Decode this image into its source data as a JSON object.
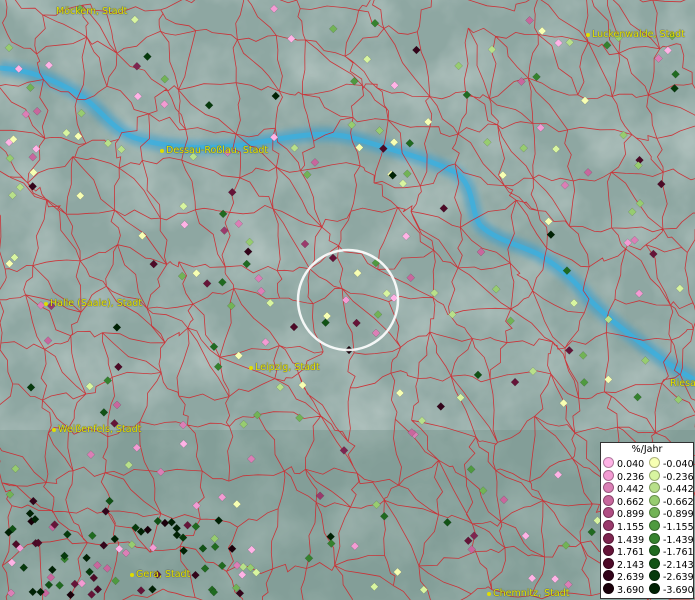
{
  "cities": [
    {
      "name": "Möckern, Stadt",
      "marker": false
    },
    {
      "name": "Luckenwalde, Stadt",
      "marker": true
    },
    {
      "name": "Dessau-Roßlau, Stadt",
      "marker": true
    },
    {
      "name": "Halle (Saale), Stadt",
      "marker": true
    },
    {
      "name": "Leipzig, Stadt",
      "marker": true
    },
    {
      "name": "Weißenfels, Stadt",
      "marker": true
    },
    {
      "name": "Gera, Stadt",
      "marker": true
    },
    {
      "name": "Chemnitz, Stadt",
      "marker": true
    },
    {
      "name": "Riesa",
      "marker": false
    }
  ],
  "legend": {
    "title": "%/Jahr",
    "positive": [
      {
        "label": "0.040",
        "color": "#ffb3e6"
      },
      {
        "label": "0.236",
        "color": "#f39bd3"
      },
      {
        "label": "0.442",
        "color": "#db7fb6"
      },
      {
        "label": "0.662",
        "color": "#c8679d"
      },
      {
        "label": "0.899",
        "color": "#b04d83"
      },
      {
        "label": "1.155",
        "color": "#9a3a6c"
      },
      {
        "label": "1.439",
        "color": "#7e2550"
      },
      {
        "label": "1.761",
        "color": "#651438"
      },
      {
        "label": "2.143",
        "color": "#4d0a27"
      },
      {
        "label": "2.639",
        "color": "#33041a"
      },
      {
        "label": "3.690",
        "color": "#1a000a"
      }
    ],
    "negative": [
      {
        "label": "-0.040",
        "color": "#f7ffb3"
      },
      {
        "label": "-0.236",
        "color": "#d8f5a0"
      },
      {
        "label": "-0.442",
        "color": "#b8e08a"
      },
      {
        "label": "-0.662",
        "color": "#97cc70"
      },
      {
        "label": "-0.899",
        "color": "#72b356"
      },
      {
        "label": "-1.155",
        "color": "#4f9a40"
      },
      {
        "label": "-1.439",
        "color": "#35822e"
      },
      {
        "label": "-1.761",
        "color": "#206a20"
      },
      {
        "label": "-2.143",
        "color": "#115215"
      },
      {
        "label": "-2.639",
        "color": "#063a0c"
      },
      {
        "label": "-3.690",
        "color": "#002204"
      }
    ]
  },
  "colors": {
    "terrain": "#8fa8a3",
    "river": "#3a9fd0",
    "borders": "#d0262b",
    "label": "#e6e600"
  },
  "markers": [
    {
      "id": "positive-site-1",
      "rate": 0.236
    },
    {
      "id": "positive-site-2",
      "rate": 0.04
    },
    {
      "id": "positive-site-3",
      "rate": 0.442
    },
    {
      "id": "negative-site-1",
      "rate": -0.442
    },
    {
      "id": "negative-site-2",
      "rate": -1.155
    },
    {
      "id": "positive-site-4",
      "rate": 2.639
    },
    {
      "id": "negative-site-3",
      "rate": -3.69
    },
    {
      "id": "positive-site-5",
      "rate": 1.761
    },
    {
      "id": "negative-site-4",
      "rate": -0.04
    }
  ],
  "selection": {
    "description": "highlighted circle selection"
  }
}
